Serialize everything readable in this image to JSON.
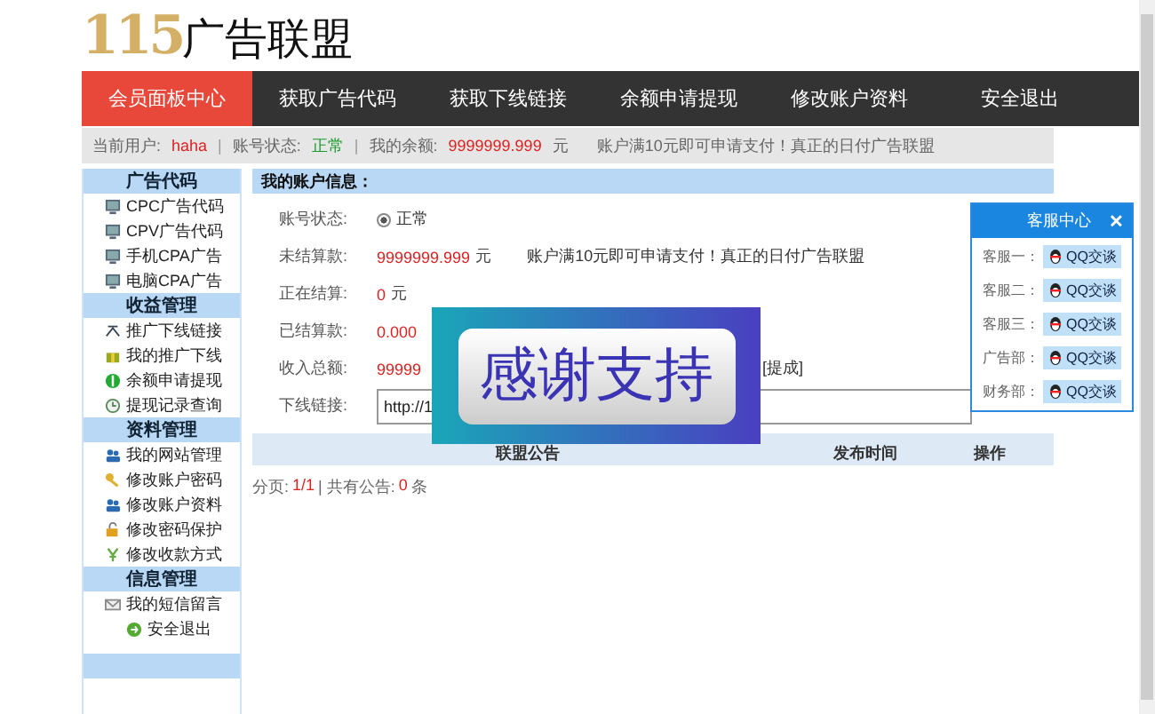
{
  "logo": {
    "number": "115",
    "name": "广告联盟"
  },
  "nav": [
    {
      "label": "会员面板中心",
      "selected": true
    },
    {
      "label": "获取广告代码",
      "selected": false
    },
    {
      "label": "获取下线链接",
      "selected": false
    },
    {
      "label": "余额申请提现",
      "selected": false
    },
    {
      "label": "修改账户资料",
      "selected": false
    },
    {
      "label": "安全退出",
      "selected": false
    }
  ],
  "info_bar": [
    {
      "label": "当前用户:",
      "value": "haha",
      "color": "#dd2222"
    },
    {
      "separator": "|",
      "label": "账号状态:",
      "value": "正常",
      "color": "#1a9a2a"
    },
    {
      "separator": "|",
      "label": "我的余额:",
      "value": "9999999.999",
      "unit": "元",
      "color": "#dd2222"
    }
  ],
  "info_note": "账户满10元即可申请支付！真正的日付广告联盟",
  "sidebar": [
    {
      "title": "广告代码",
      "items": [
        "CPC广告代码",
        "CPV广告代码",
        "手机CPA广告",
        "电脑CPA广告"
      ]
    },
    {
      "title": "收益管理",
      "items": [
        "推广下线链接",
        "我的推广下线",
        "余额申请提现",
        "提现记录查询"
      ]
    },
    {
      "title": "资料管理",
      "items": [
        "我的网站管理",
        "修改账户密码",
        "修改账户资料",
        "修改密码保护",
        "修改收款方式"
      ]
    },
    {
      "title": "信息管理",
      "items": [
        "我的短信留言",
        "安全退出"
      ]
    }
  ],
  "account": {
    "title": "我的账户信息：",
    "rows": [
      {
        "kind": "radio",
        "label": "账号状态:",
        "value": "正常",
        "checked": true
      },
      {
        "kind": "money",
        "label": "未结算款:",
        "value": "9999999.999",
        "unit": "元",
        "note": "账户满10元即可申请支付！真正的日付广告联盟"
      },
      {
        "kind": "money",
        "label": "正在结算:",
        "value": "0",
        "unit": "元"
      },
      {
        "kind": "money",
        "label": "已结算款:",
        "value": "0.000"
      },
      {
        "kind": "money",
        "label": "收入总额:",
        "value": "99999",
        "note": "[提成]"
      },
      {
        "kind": "input",
        "label": "下线链接:",
        "value": "http://1"
      }
    ]
  },
  "notices": {
    "columns": [
      "联盟公告",
      "发布时间",
      "操作"
    ],
    "pager": {
      "label": "分页:",
      "page": "1/1",
      "count_label": "| 共有公告:",
      "count": "0",
      "unit": "条"
    }
  },
  "popup": {
    "text": "感谢支持"
  },
  "service": {
    "title": "客服中心",
    "close": "✕",
    "contacts": [
      {
        "label": "客服一：",
        "button": "QQ交谈"
      },
      {
        "label": "客服二：",
        "button": "QQ交谈"
      },
      {
        "label": "客服三：",
        "button": "QQ交谈"
      },
      {
        "label": "广告部：",
        "button": "QQ交谈"
      },
      {
        "label": "财务部：",
        "button": "QQ交谈"
      }
    ]
  }
}
